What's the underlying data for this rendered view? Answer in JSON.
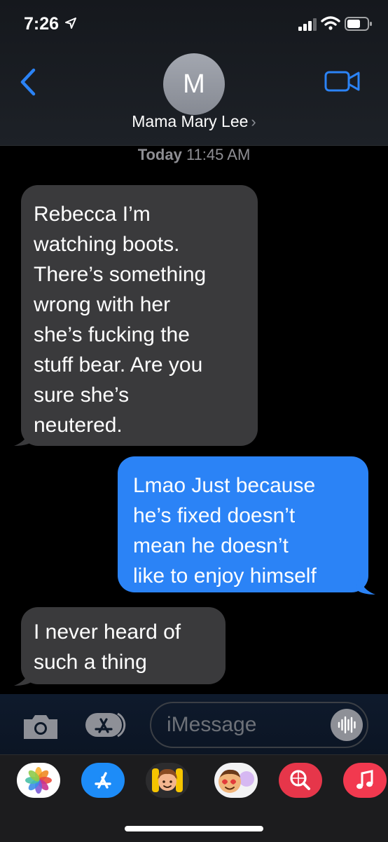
{
  "status_bar": {
    "time": "7:26"
  },
  "header": {
    "avatar_initial": "M",
    "contact_name": "Mama Mary Lee",
    "chevron": "›"
  },
  "thread": {
    "timestamp_day": "Today",
    "timestamp_time": "11:45 AM",
    "messages": [
      {
        "direction": "incoming",
        "text": "Rebecca I’m\nwatching boots.\nThere’s something\nwrong with her\nshe’s fucking the\nstuff bear. Are you\nsure she’s\nneutered."
      },
      {
        "direction": "outgoing",
        "text": "Lmao Just because\nhe’s fixed doesn’t\nmean he doesn’t\nlike to enjoy himself"
      },
      {
        "direction": "incoming",
        "text": "I never heard of\nsuch a thing"
      }
    ]
  },
  "composer": {
    "placeholder": "iMessage"
  },
  "colors": {
    "incoming_bubble": "#3a3a3c",
    "outgoing_bubble": "#2b83f6",
    "accent": "#2b83f6"
  },
  "icons": {
    "back": "chevron-left-icon",
    "video": "video-camera-icon",
    "camera": "camera-icon",
    "apps": "app-store-icon",
    "audio": "waveform-icon",
    "drawer": [
      "photos-icon",
      "app-store-icon",
      "memoji-icon",
      "animoji-icon",
      "search-images-icon",
      "music-icon"
    ]
  }
}
